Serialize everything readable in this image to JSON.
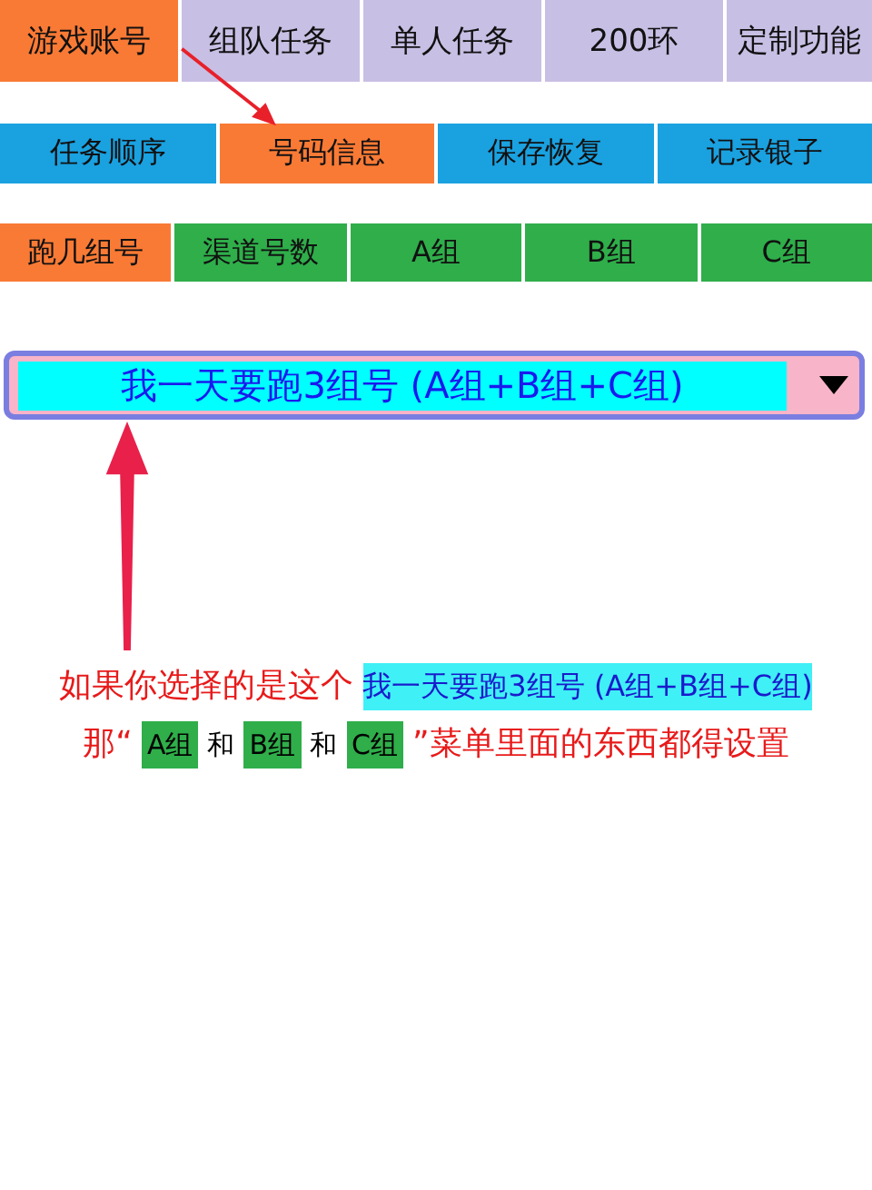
{
  "top_tabs": [
    {
      "label": "游戏账号",
      "selected": true
    },
    {
      "label": "组队任务",
      "selected": false
    },
    {
      "label": "单人任务",
      "selected": false
    },
    {
      "label": "200环",
      "selected": false
    },
    {
      "label": "定制功能",
      "selected": false
    }
  ],
  "sub_tabs": [
    {
      "label": "任务顺序",
      "selected": false
    },
    {
      "label": "号码信息",
      "selected": true
    },
    {
      "label": "保存恢复",
      "selected": false
    },
    {
      "label": "记录银子",
      "selected": false
    }
  ],
  "group_tabs": [
    {
      "label": "跑几组号",
      "selected": true
    },
    {
      "label": "渠道号数",
      "selected": false
    },
    {
      "label": "A组",
      "selected": false
    },
    {
      "label": "B组",
      "selected": false
    },
    {
      "label": "C组",
      "selected": false
    }
  ],
  "dropdown": {
    "value": "我一天要跑3组号 (A组+B组+C组)"
  },
  "annotation_lines": [
    [
      {
        "kind": "red",
        "text": "如果你选择的是这个"
      },
      {
        "kind": "highlight",
        "text": "我一天要跑3组号 (A组+B组+C组)"
      }
    ],
    [
      {
        "kind": "red",
        "text": "那“"
      },
      {
        "kind": "tag",
        "text": "A组"
      },
      {
        "kind": "plain",
        "text": "和"
      },
      {
        "kind": "tag",
        "text": "B组"
      },
      {
        "kind": "plain",
        "text": "和"
      },
      {
        "kind": "tag",
        "text": "C组"
      },
      {
        "kind": "red",
        "text": "”菜单里面的东西都得设置"
      }
    ]
  ]
}
